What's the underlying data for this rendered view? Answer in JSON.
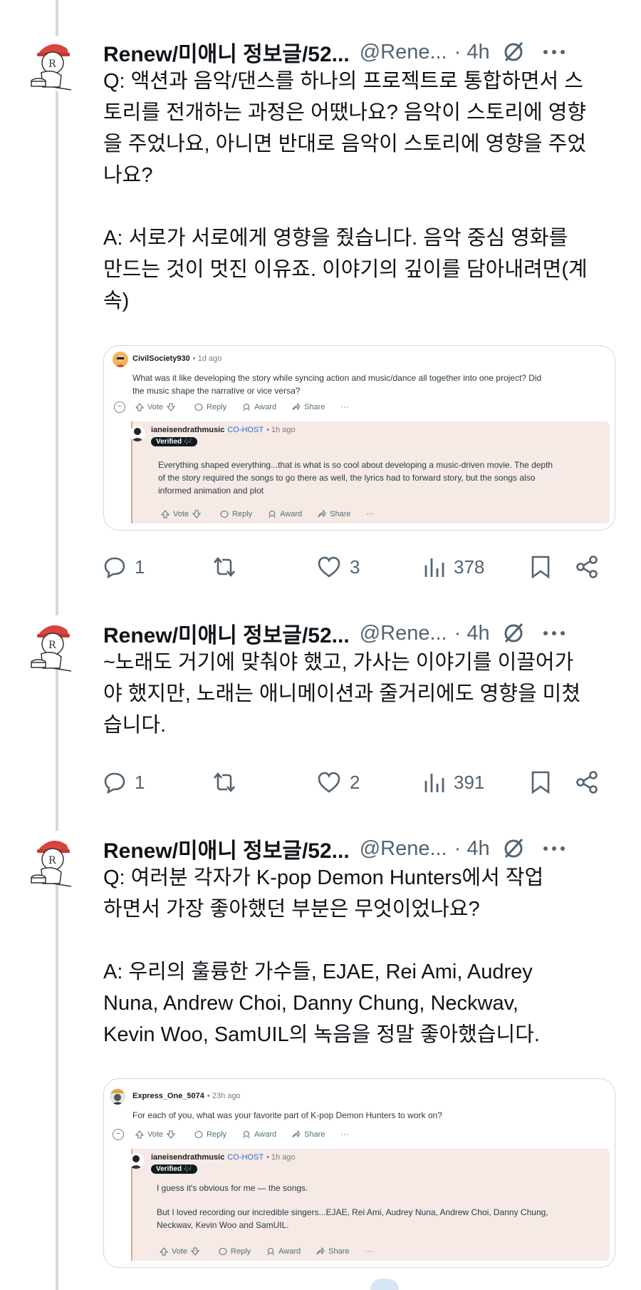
{
  "tweets": [
    {
      "author": "Renew/미애니 정보글/52...",
      "handle": "@Rene...",
      "time": "· 4h",
      "lines": [
        "Q: 액션과 음악/댄스를 하나의 프로젝트로 통합하면서 스",
        "토리를 전개하는 과정은 어땠나요? 음악이 스토리에 영향",
        "을 주었나요, 아니면 반대로 음악이 스토리에 영향을 주었",
        "나요?",
        "",
        "A: 서로가 서로에게 영향을 줬습니다. 음악 중심 영화를",
        "만드는 것이 멋진 이유죠. 이야기의 깊이를 담아내려면(계",
        "속)"
      ],
      "embed": {
        "comment_user": "CivilSociety930",
        "comment_time": "• 1d ago",
        "comment_lines": [
          "What was it like developing the story while syncing action and music/dance all together into one project? Did",
          "the music shape the narrative or vice versa?"
        ],
        "reply_user": "ianeisendrathmusic",
        "reply_role": "CO-HOST",
        "reply_time": "• 1h ago",
        "reply_badge": "Verified 🎶",
        "reply_lines": [
          "Everything shaped everything...that is what is so cool about developing a music-driven movie. The depth",
          "of the story required the songs to go there as well, the lyrics had to forward story, but the songs also",
          "informed animation and plot"
        ]
      },
      "stats": {
        "replies": "1",
        "retweets": "",
        "likes": "3",
        "views": "378"
      }
    },
    {
      "author": "Renew/미애니 정보글/52...",
      "handle": "@Rene...",
      "time": "· 4h",
      "lines": [
        "~노래도 거기에 맞춰야 했고, 가사는 이야기를 이끌어가",
        "야 했지만, 노래는 애니메이션과 줄거리에도 영향을 미쳤",
        "습니다."
      ],
      "stats": {
        "replies": "1",
        "retweets": "",
        "likes": "2",
        "views": "391"
      }
    },
    {
      "author": "Renew/미애니 정보글/52...",
      "handle": "@Rene...",
      "time": "· 4h",
      "lines": [
        "Q:  여러분 각자가 K-pop Demon Hunters에서 작업",
        "하면서 가장 좋아했던 부분은 무엇이었나요?",
        "",
        "A:  우리의 훌륭한 가수들, EJAE, Rei Ami, Audrey",
        "Nuna, Andrew Choi, Danny Chung, Neckwav,",
        "Kevin Woo, SamUIL의 녹음을 정말 좋아했습니다."
      ],
      "embed": {
        "comment_user": "Express_One_5074",
        "comment_time": "• 23h ago",
        "comment_lines": [
          "For each of you, what was your favorite part of K-pop Demon Hunters to work on?"
        ],
        "reply_user": "ianeisendrathmusic",
        "reply_role": "CO-HOST",
        "reply_time": "• 1h ago",
        "reply_badge": "Verified 🎶",
        "reply_lines": [
          "I guess it's obvious for me — the songs.",
          "",
          "But I loved recording our incredible singers...EJAE, Rei Ami, Audrey Nuna, Andrew Choi, Danny Chung,",
          "Neckwav, Kevin Woo and SamUIL."
        ]
      }
    }
  ],
  "reddit_actions": {
    "vote": "Vote",
    "reply": "Reply",
    "award": "Award",
    "share": "Share",
    "more": "···"
  },
  "colors": {
    "accent": "#1d9bf0",
    "muted": "#536471",
    "thread": "#cfd9de",
    "reply_bg": "#f6eae6"
  },
  "icons": [
    "reply-icon",
    "retweet-icon",
    "like-icon",
    "views-icon",
    "bookmark-icon",
    "share-icon",
    "grok-icon",
    "more-icon"
  ]
}
